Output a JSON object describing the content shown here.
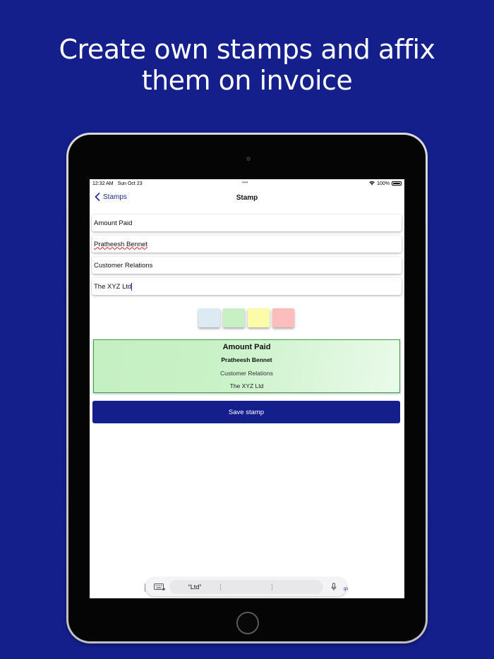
{
  "headline": {
    "line1": "Create own stamps and affix",
    "line2": "them on invoice"
  },
  "status_bar": {
    "time": "12:32 AM",
    "date": "Sun Oct 23",
    "battery": "100%"
  },
  "nav": {
    "back_label": "Stamps",
    "title": "Stamp"
  },
  "form": {
    "line1_value": "Amount Paid",
    "line2_value": "Pratheesh Bennet",
    "line3_value": "Customer Relations",
    "line4_value": "The XYZ Ltd"
  },
  "swatches": [
    {
      "name": "blue",
      "color": "#dcebf3"
    },
    {
      "name": "green",
      "color": "#c8f0c5"
    },
    {
      "name": "yellow",
      "color": "#fbfba8"
    },
    {
      "name": "red",
      "color": "#fdbdbd"
    }
  ],
  "preview": {
    "line1": "Amount Paid",
    "line2": "Pratheesh Bennet",
    "line3": "Customer Relations",
    "line4": "The XYZ Ltd",
    "border_color": "#3aa34a"
  },
  "save_label": "Save stamp",
  "keyboard": {
    "suggestion1": "“Ltd”",
    "suggestion2": "",
    "suggestion3": "",
    "partial_tab": "gs"
  },
  "colors": {
    "background": "#141f8c",
    "accent": "#1d2a9c"
  }
}
